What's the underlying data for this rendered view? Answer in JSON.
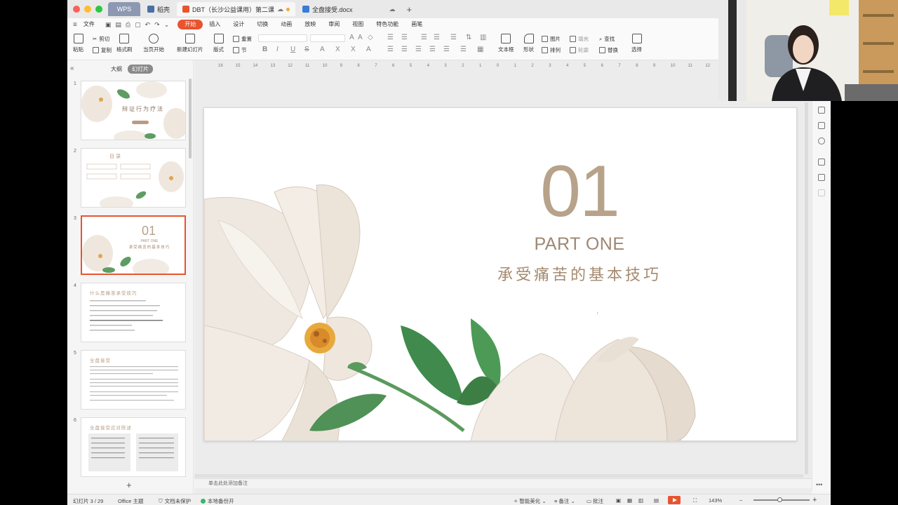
{
  "tabs": {
    "wps": "WPS",
    "docer": "稻壳",
    "active_doc": "DBT（长沙公益课用）第二课",
    "other_doc": "全盘接受.docx",
    "add": "+"
  },
  "menu": {
    "file": "文件",
    "items": [
      "开始",
      "插入",
      "设计",
      "切换",
      "动画",
      "放映",
      "审阅",
      "视图",
      "特色功能",
      "画笔"
    ]
  },
  "ribbon": {
    "paste": "粘贴",
    "cut": "剪切",
    "copy": "复制",
    "format_painter": "格式刷",
    "from_current": "当页开始",
    "new_slide": "新建幻灯片",
    "layout": "版式",
    "reset": "重置",
    "section": "节",
    "textbox": "文本框",
    "shape": "形状",
    "picture": "图片",
    "arrange": "排列",
    "fill": "填充",
    "outline": "轮廓",
    "find": "查找",
    "replace": "替换",
    "select": "选择"
  },
  "leftpanel": {
    "collapse": "«",
    "outline": "大纲",
    "slides": "幻灯片",
    "add": "+",
    "thumbs": [
      {
        "num": "1",
        "title": "辩证行为疗法"
      },
      {
        "num": "2",
        "title": "目 录"
      },
      {
        "num": "3",
        "big": "01",
        "sub": "PART ONE",
        "title": "承受痛苦的基本技巧"
      },
      {
        "num": "4",
        "title": "什么是痛苦承受技巧"
      },
      {
        "num": "5",
        "title": "全盘接受"
      },
      {
        "num": "6",
        "title": "全盘接受应对陈述"
      }
    ]
  },
  "ruler": [
    "16",
    "15",
    "14",
    "13",
    "12",
    "11",
    "10",
    "9",
    "8",
    "7",
    "6",
    "5",
    "4",
    "3",
    "2",
    "1",
    "0",
    "1",
    "2",
    "3",
    "4",
    "5",
    "6",
    "7",
    "8",
    "9",
    "10",
    "11",
    "12"
  ],
  "slide": {
    "big_number": "01",
    "part": "PART ONE",
    "subtitle": "承受痛苦的基本技巧"
  },
  "notes_placeholder": "单击此处添加备注",
  "status": {
    "slide_counter": "幻灯片 3 / 29",
    "theme": "Office 主题",
    "protect": "文档未保护",
    "backup": "本地备份开",
    "beautify": "智能美化",
    "notes": "备注",
    "comments": "批注",
    "zoom": "143%",
    "zoom_minus": "−",
    "zoom_plus": "+"
  },
  "colors": {
    "accent": "#e8542f",
    "title_brown": "#b7a28a"
  }
}
